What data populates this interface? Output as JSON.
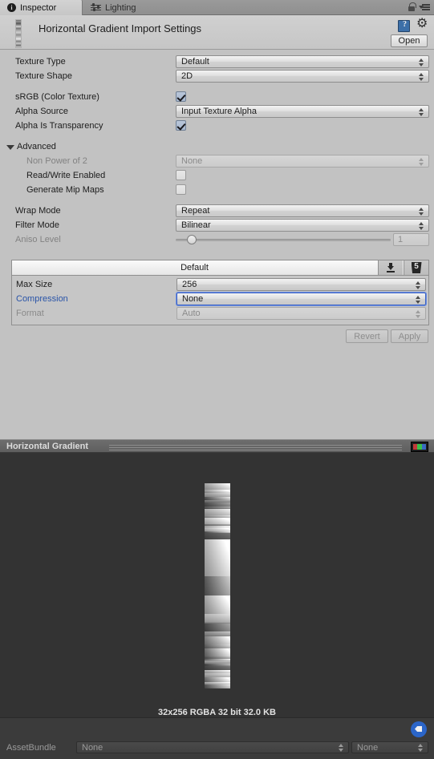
{
  "tabs": [
    {
      "label": "Inspector",
      "icon": "info-icon",
      "active": true
    },
    {
      "label": "Lighting",
      "icon": "lighting-icon",
      "active": false
    }
  ],
  "tabbar": {
    "lock_icon": "lock-icon",
    "menu_icon": "hamburger-menu-icon"
  },
  "header": {
    "title": "Horizontal Gradient Import Settings",
    "help_icon": "help-book-icon",
    "gear_icon": "gear-icon",
    "open_label": "Open",
    "thumbnail": "texture-thumbnail"
  },
  "properties": [
    {
      "label": "Texture Type",
      "type": "dropdown",
      "value": "Default"
    },
    {
      "label": "Texture Shape",
      "type": "dropdown",
      "value": "2D"
    },
    {
      "label": "sRGB (Color Texture)",
      "type": "checkbox",
      "checked": true
    },
    {
      "label": "Alpha Source",
      "type": "dropdown",
      "value": "Input Texture Alpha"
    },
    {
      "label": "Alpha Is Transparency",
      "type": "checkbox",
      "checked": true
    }
  ],
  "advanced": {
    "label": "Advanced",
    "expanded": true,
    "items": [
      {
        "label": "Non Power of 2",
        "type": "dropdown",
        "value": "None",
        "disabled": true
      },
      {
        "label": "Read/Write Enabled",
        "type": "checkbox",
        "checked": false
      },
      {
        "label": "Generate Mip Maps",
        "type": "checkbox",
        "checked": false
      }
    ]
  },
  "sampling": [
    {
      "label": "Wrap Mode",
      "type": "dropdown",
      "value": "Repeat"
    },
    {
      "label": "Filter Mode",
      "type": "dropdown",
      "value": "Bilinear"
    }
  ],
  "aniso": {
    "label": "Aniso Level",
    "value": "1",
    "slider_percent": 5
  },
  "platform": {
    "tab_label": "Default",
    "download_icon": "standalone-platform-icon",
    "web_icon": "webgl-platform-icon",
    "rows": [
      {
        "label": "Max Size",
        "value": "256",
        "state": "normal"
      },
      {
        "label": "Compression",
        "value": "None",
        "state": "focused"
      },
      {
        "label": "Format",
        "value": "Auto",
        "state": "disabled"
      }
    ]
  },
  "actions": {
    "revert_label": "Revert",
    "apply_label": "Apply"
  },
  "preview": {
    "title": "Horizontal Gradient",
    "rgb_icon": "rgb-channel-icon",
    "info": "32x256  RGBA 32 bit   32.0 KB",
    "texture_width": 32,
    "texture_height": 256
  },
  "bottom": {
    "tag_icon": "asset-label-icon",
    "assetbundle_label": "AssetBundle",
    "assetbundle_value": "None",
    "variant_value": "None"
  },
  "colors": {
    "window_bg": "#c2c2c2",
    "preview_bg": "#333333",
    "bottom_bg": "#3b3b3b",
    "accent_blue": "#2954a8",
    "focus_blue": "#3c62c4",
    "tag_blue": "#2b65c8"
  }
}
